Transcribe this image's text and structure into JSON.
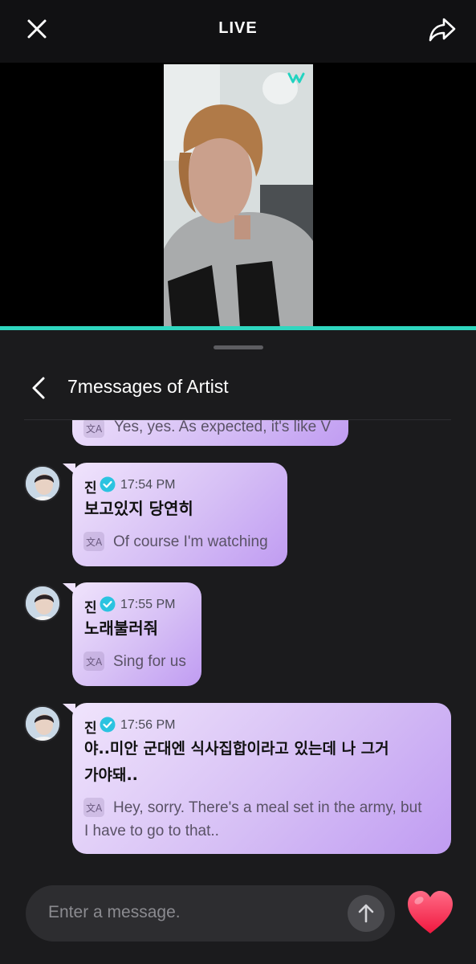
{
  "header": {
    "title": "LIVE",
    "close_icon": "close-icon",
    "share_icon": "share-icon"
  },
  "video": {
    "progress": 1.0,
    "logo_icon": "weverse-logo-icon",
    "accent": "#2fd6bf"
  },
  "panel": {
    "title": "7messages of Artist",
    "back_icon": "chevron-left-icon"
  },
  "partial_message": {
    "translation": "Yes, yes. As expected, it's like V"
  },
  "messages": [
    {
      "sender": "진",
      "time": "17:54 PM",
      "text": "보고있지 당연히",
      "translation": "Of course I'm watching"
    },
    {
      "sender": "진",
      "time": "17:55 PM",
      "text": "노래불러줘",
      "translation": "Sing for us"
    },
    {
      "sender": "진",
      "time": "17:56 PM",
      "text_line1": "야..미안 군대엔 식사집합이라고 있는데 나 그거",
      "text_line2": "가야돼..",
      "translation_line1": "Hey, sorry. There's a meal set in the army, but",
      "translation_line2": "I have to go to that.."
    }
  ],
  "composer": {
    "placeholder": "Enter a message.",
    "send_icon": "arrow-up-icon",
    "heart_icon": "heart-icon",
    "heart_color": "#ff3b5c"
  },
  "colors": {
    "bubble": "#d6bff5",
    "verified": "#2bc3e0",
    "background": "#1b1b1d"
  }
}
